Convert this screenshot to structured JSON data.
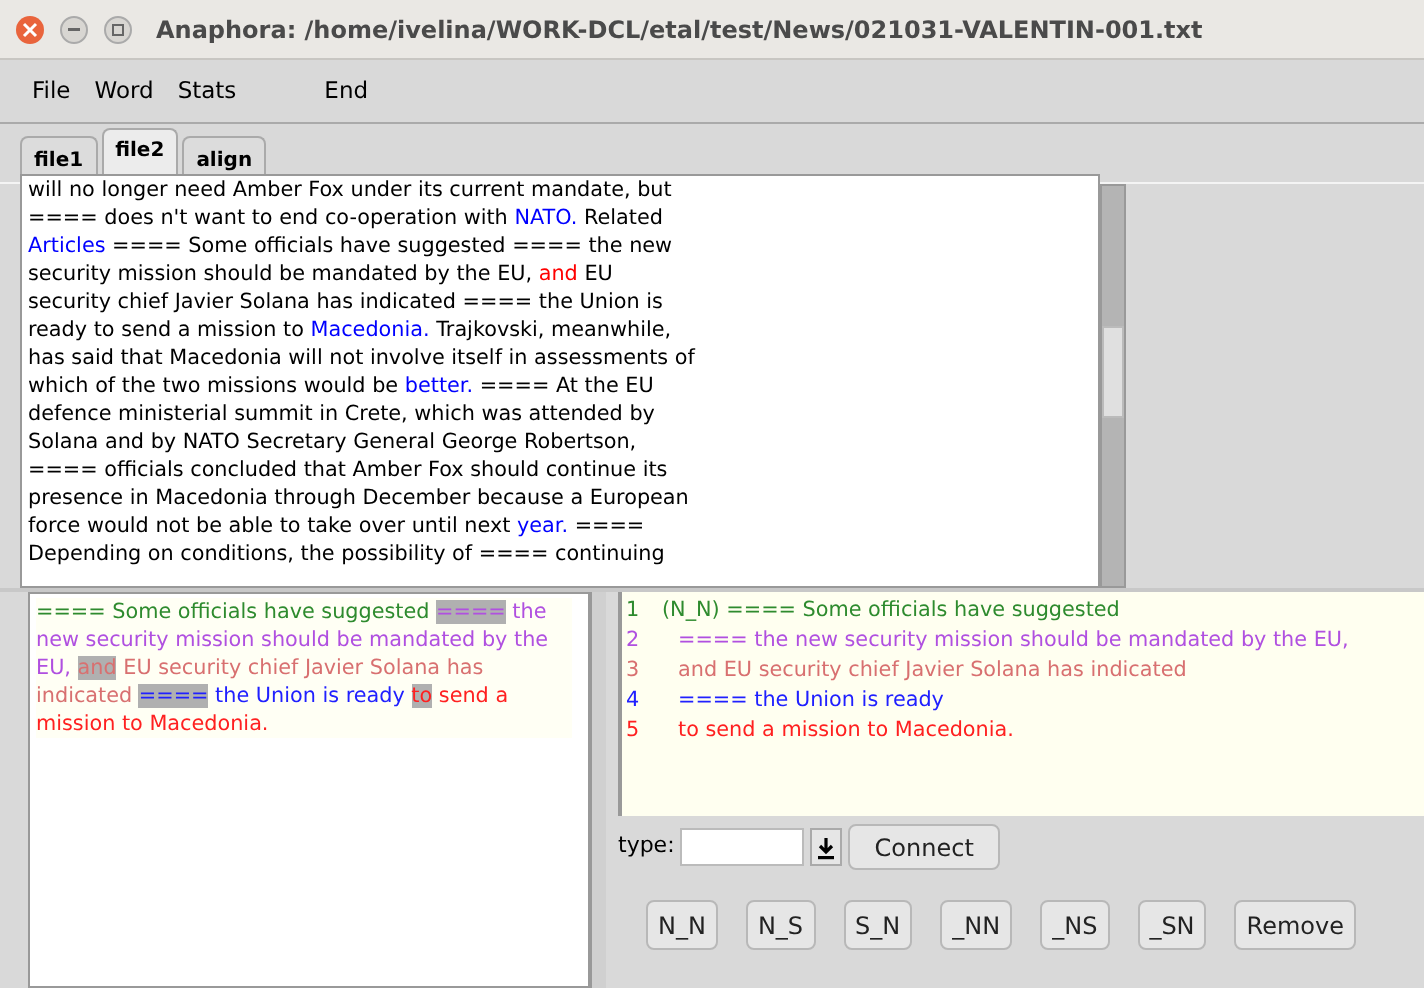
{
  "window": {
    "title": "Anaphora: /home/ivelina/WORK-DCL/etal/test/News/021031-VALENTIN-001.txt"
  },
  "menu": [
    "File",
    "Word",
    "Stats",
    "End"
  ],
  "tabs": [
    {
      "label": "file1",
      "selected": false
    },
    {
      "label": "file2",
      "selected": true
    },
    {
      "label": "align",
      "selected": false
    }
  ],
  "text_lines": [
    [
      {
        "text": "will no longer need Amber Fox under its current mandate, but",
        "color": "#000000"
      }
    ],
    [
      {
        "text": "==== does n't want to end co-operation with ",
        "color": "#000000"
      },
      {
        "text": "NATO.",
        "color": "#0000ff"
      },
      {
        "text": " Related",
        "color": "#000000"
      }
    ],
    [
      {
        "text": "Articles",
        "color": "#0000ff"
      },
      {
        "text": " ==== Some officials have suggested ==== the new",
        "color": "#000000"
      }
    ],
    [
      {
        "text": "security mission should be mandated by the EU, ",
        "color": "#000000"
      },
      {
        "text": "and",
        "color": "#ff0000"
      },
      {
        "text": " EU",
        "color": "#000000"
      }
    ],
    [
      {
        "text": "security chief Javier Solana has indicated ==== the Union is",
        "color": "#000000"
      }
    ],
    [
      {
        "text": "ready to send a mission to ",
        "color": "#000000"
      },
      {
        "text": "Macedonia.",
        "color": "#0000ff"
      },
      {
        "text": " Trajkovski, meanwhile,",
        "color": "#000000"
      }
    ],
    [
      {
        "text": "has said that Macedonia will not involve itself in assessments of",
        "color": "#000000"
      }
    ],
    [
      {
        "text": "which of the two missions would be ",
        "color": "#000000"
      },
      {
        "text": "better.",
        "color": "#0000ff"
      },
      {
        "text": " ==== At the EU",
        "color": "#000000"
      }
    ],
    [
      {
        "text": "defence ministerial summit in Crete, which was attended by",
        "color": "#000000"
      }
    ],
    [
      {
        "text": "Solana and by NATO Secretary General George Robertson,",
        "color": "#000000"
      }
    ],
    [
      {
        "text": "==== officials concluded that Amber Fox should continue its",
        "color": "#000000"
      }
    ],
    [
      {
        "text": "presence in Macedonia through December because a European",
        "color": "#000000"
      }
    ],
    [
      {
        "text": "force would not be able to take over until next ",
        "color": "#000000"
      },
      {
        "text": "year.",
        "color": "#0000ff"
      },
      {
        "text": " ====",
        "color": "#000000"
      }
    ],
    [
      {
        "text": "Depending on conditions, the possibility of ==== continuing",
        "color": "#000000"
      }
    ]
  ],
  "segments": [
    {
      "text": "====",
      "color": "#2e8b2e",
      "highlighted": false
    },
    {
      "text": " Some officials have suggested ",
      "color": "#2e8b2e",
      "highlighted": false
    },
    {
      "text": "====",
      "color": "#b050e0",
      "highlighted": true
    },
    {
      "text": " the new security mission should be mandated by the EU, ",
      "color": "#b050e0",
      "highlighted": false
    },
    {
      "text": "and",
      "color": "#d87070",
      "highlighted": true
    },
    {
      "text": " EU security chief Javier Solana has indicated ",
      "color": "#d87070",
      "highlighted": false
    },
    {
      "text": "====",
      "color": "#2020ff",
      "highlighted": true
    },
    {
      "text": " the Union is ready ",
      "color": "#2020ff",
      "highlighted": false
    },
    {
      "text": "to",
      "color": "#ff2020",
      "highlighted": true
    },
    {
      "text": " send a mission to Macedonia.",
      "color": "#ff2020",
      "highlighted": false
    }
  ],
  "numbered_lines": [
    {
      "number": "1",
      "text": "(N_N) ==== Some officials have suggested",
      "color": "#2e8b2e"
    },
    {
      "number": "2",
      "text": "==== the new security mission should be mandated by the EU,",
      "color": "#b050e0"
    },
    {
      "number": "3",
      "text": "and EU security chief Javier Solana has indicated",
      "color": "#d87070"
    },
    {
      "number": "4",
      "text": "==== the Union is ready",
      "color": "#2020ff"
    },
    {
      "number": "5",
      "text": "to send a mission to Macedonia.",
      "color": "#ff2020"
    }
  ],
  "type_label": "type:",
  "connect_button": "Connect",
  "link_buttons": [
    "N_N",
    "N_S",
    "S_N",
    "_NN",
    "_NS",
    "_SN",
    "Remove"
  ]
}
